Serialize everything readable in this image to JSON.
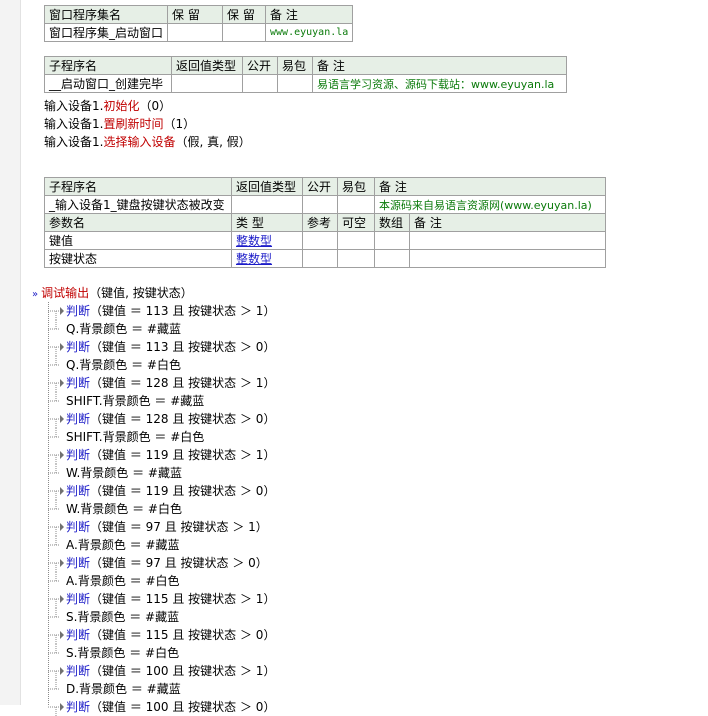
{
  "table1": {
    "headers": [
      "窗口程序集名",
      "保 留",
      "保 留",
      "备 注"
    ],
    "row": [
      "窗口程序集_启动窗口",
      "",
      "",
      "www.eyuyan.la"
    ]
  },
  "table2": {
    "headers": [
      "子程序名",
      "返回值类型",
      "公开",
      "易包",
      "备 注"
    ],
    "row": [
      "__启动窗口_创建完毕",
      "",
      "",
      "",
      "易语言学习资源、源码下载站：www.eyuyan.la"
    ]
  },
  "init_lines": [
    {
      "prefix": "输入设备1.",
      "call": "初始化",
      "args": "（0）"
    },
    {
      "prefix": "输入设备1.",
      "call": "置刷新时间",
      "args": "（1）"
    },
    {
      "prefix": "输入设备1.",
      "call": "选择输入设备",
      "args": "（假, 真, 假）"
    }
  ],
  "table3": {
    "headers": [
      "子程序名",
      "返回值类型",
      "公开",
      "易包",
      "备 注"
    ],
    "row": [
      "_输入设备1_键盘按键状态被改变",
      "",
      "",
      "",
      "本源码来自易语言资源网(www.eyuyan.la)"
    ],
    "param_headers": [
      "参数名",
      "类 型",
      "参考",
      "可空",
      "数组",
      "备 注"
    ],
    "params": [
      {
        "name": "键值",
        "type": "整数型"
      },
      {
        "name": "按键状态",
        "type": "整数型"
      }
    ]
  },
  "debug": {
    "call": "调试输出",
    "args": "（键值, 按键状态）"
  },
  "code_lines": [
    {
      "kind": "if",
      "kw": "判断",
      "text": "（键值 ＝ 113 且 按键状态 ＞ 1）"
    },
    {
      "kind": "st",
      "text": "Q.背景颜色 ＝ #藏蓝"
    },
    {
      "kind": "if",
      "kw": "判断",
      "text": "（键值 ＝ 113 且 按键状态 ＞ 0）"
    },
    {
      "kind": "st",
      "text": "Q.背景颜色 ＝ #白色"
    },
    {
      "kind": "if",
      "kw": "判断",
      "text": "（键值 ＝ 128 且 按键状态 ＞ 1）"
    },
    {
      "kind": "st",
      "text": "SHIFT.背景颜色 ＝ #藏蓝"
    },
    {
      "kind": "if",
      "kw": "判断",
      "text": "（键值 ＝ 128 且 按键状态 ＞ 0）"
    },
    {
      "kind": "st",
      "text": "SHIFT.背景颜色 ＝ #白色"
    },
    {
      "kind": "if",
      "kw": "判断",
      "text": "（键值 ＝ 119 且 按键状态 ＞ 1）"
    },
    {
      "kind": "st",
      "text": "W.背景颜色 ＝ #藏蓝"
    },
    {
      "kind": "if",
      "kw": "判断",
      "text": "（键值 ＝ 119 且 按键状态 ＞ 0）"
    },
    {
      "kind": "st",
      "text": "W.背景颜色 ＝ #白色"
    },
    {
      "kind": "if",
      "kw": "判断",
      "text": "（键值 ＝ 97 且 按键状态 ＞ 1）"
    },
    {
      "kind": "st",
      "text": "A.背景颜色 ＝ #藏蓝"
    },
    {
      "kind": "if",
      "kw": "判断",
      "text": "（键值 ＝ 97 且 按键状态 ＞ 0）"
    },
    {
      "kind": "st",
      "text": "A.背景颜色 ＝ #白色"
    },
    {
      "kind": "if",
      "kw": "判断",
      "text": "（键值 ＝ 115 且 按键状态 ＞ 1）"
    },
    {
      "kind": "st",
      "text": "S.背景颜色 ＝ #藏蓝"
    },
    {
      "kind": "if",
      "kw": "判断",
      "text": "（键值 ＝ 115 且 按键状态 ＞ 0）"
    },
    {
      "kind": "st",
      "text": "S.背景颜色 ＝ #白色"
    },
    {
      "kind": "if",
      "kw": "判断",
      "text": "（键值 ＝ 100 且 按键状态 ＞ 1）"
    },
    {
      "kind": "st",
      "text": "D.背景颜色 ＝ #藏蓝"
    },
    {
      "kind": "if",
      "kw": "判断",
      "text": "（键值 ＝ 100 且 按键状态 ＞ 0）"
    }
  ]
}
